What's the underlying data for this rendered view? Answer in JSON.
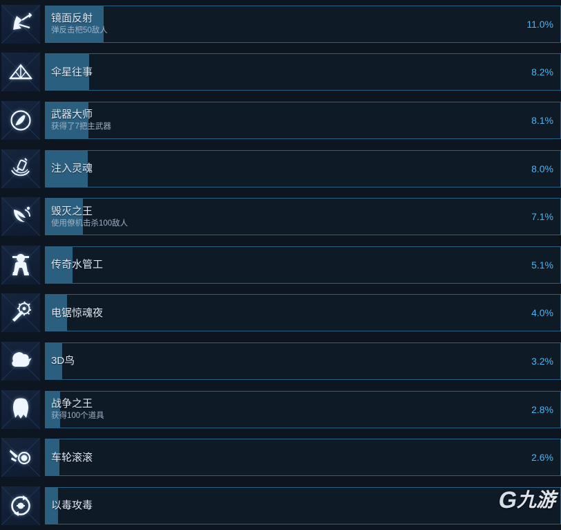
{
  "page": {
    "background_color": "#0d1521",
    "bar_border_color": "#2c6183",
    "bar_fill_color": "#2a5f7f",
    "percent_color": "#4fb3ef",
    "name_color": "#dfe9f5",
    "desc_color": "#9fb0c2"
  },
  "watermark": {
    "mark": "G",
    "text": "九游"
  },
  "achievements": [
    {
      "icon": "arrow-ricochet-icon",
      "name": "镜面反射",
      "description": "弹反击杷50敌人",
      "percent": "11.0%",
      "percent_value": 11.0
    },
    {
      "icon": "triangle-umbrella-icon",
      "name": "伞星往事",
      "description": "",
      "percent": "8.2%",
      "percent_value": 8.2
    },
    {
      "icon": "weapon-badge-icon",
      "name": "武器大师",
      "description": "获得了7把主武器",
      "percent": "8.1%",
      "percent_value": 8.1
    },
    {
      "icon": "soul-injection-icon",
      "name": "注入灵魂",
      "description": "",
      "percent": "8.0%",
      "percent_value": 8.0
    },
    {
      "icon": "drone-wing-icon",
      "name": "毁灭之王",
      "description": "使用僚机击杀100敌人",
      "percent": "7.1%",
      "percent_value": 7.1
    },
    {
      "icon": "plumber-icon",
      "name": "传奇水管工",
      "description": "",
      "percent": "5.1%",
      "percent_value": 5.1
    },
    {
      "icon": "chainsaw-icon",
      "name": "电锯惊魂夜",
      "description": "",
      "percent": "4.0%",
      "percent_value": 4.0
    },
    {
      "icon": "bird-3d-icon",
      "name": "3D鸟",
      "description": "",
      "percent": "3.2%",
      "percent_value": 3.2
    },
    {
      "icon": "war-medal-icon",
      "name": "战争之王",
      "description": "获得100个道具",
      "percent": "2.8%",
      "percent_value": 2.8
    },
    {
      "icon": "wheel-icon",
      "name": "车轮滚滚",
      "description": "",
      "percent": "2.6%",
      "percent_value": 2.6
    },
    {
      "icon": "poison-orbit-icon",
      "name": "以毒攻毒",
      "description": "",
      "percent": "",
      "percent_value": null
    }
  ]
}
